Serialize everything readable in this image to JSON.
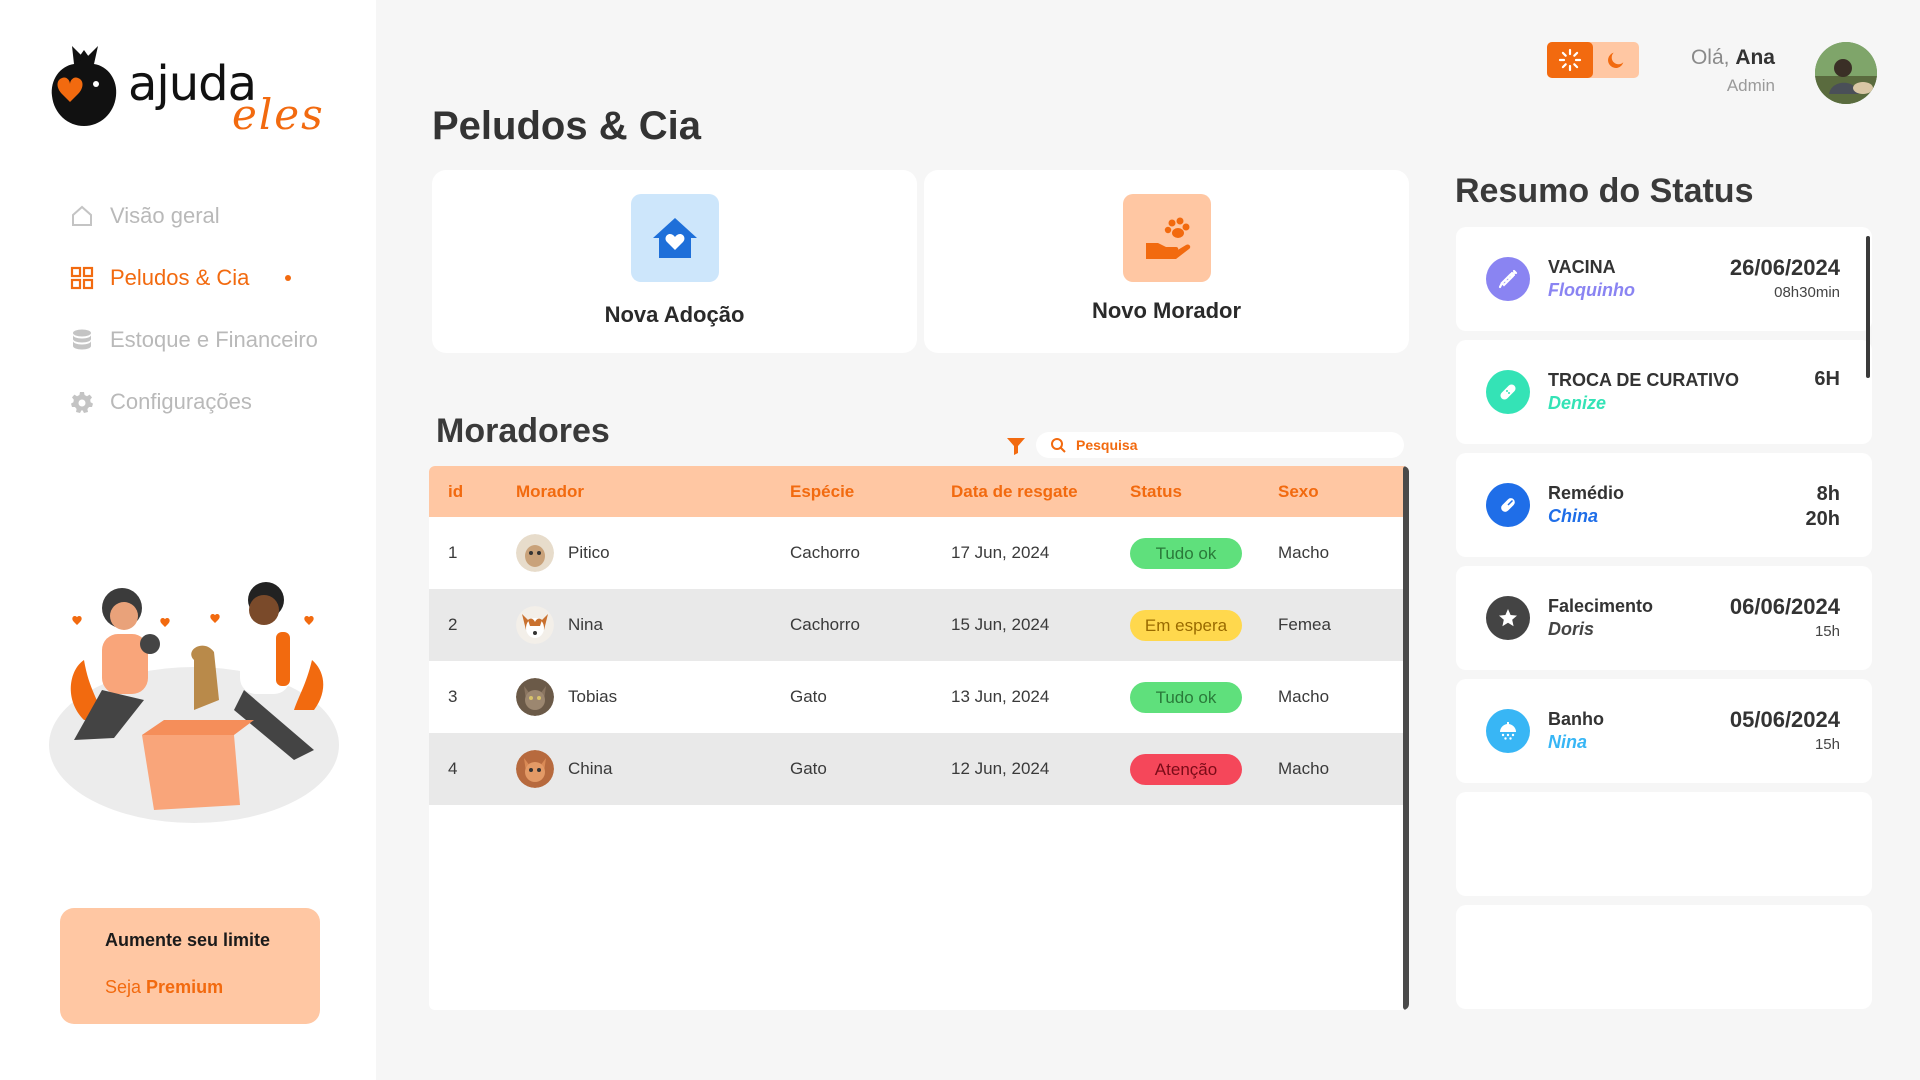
{
  "brand": {
    "name": "ajuda",
    "script": "eles"
  },
  "nav": [
    {
      "label": "Visão geral",
      "icon": "home-icon",
      "active": false
    },
    {
      "label": "Peludos & Cia",
      "icon": "grid-icon",
      "active": true
    },
    {
      "label": "Estoque e Financeiro",
      "icon": "database-icon",
      "active": false
    },
    {
      "label": "Configurações",
      "icon": "gear-icon",
      "active": false
    }
  ],
  "premium": {
    "title": "Aumente seu limite",
    "cta_prefix": "Seja",
    "cta_strong": "Premium"
  },
  "header": {
    "title": "Peludos & Cia",
    "greeting": "Olá,",
    "user_name": "Ana",
    "user_role": "Admin",
    "theme": "light"
  },
  "actions": {
    "adoption": {
      "label": "Nova Adoção",
      "icon": "home-heart-icon",
      "color": "#1e6fd9",
      "bg": "#cde6fb"
    },
    "resident": {
      "label": "Novo Morador",
      "icon": "paw-hand-icon",
      "color": "#f26a0f",
      "bg": "#ffc7a3"
    }
  },
  "residents": {
    "title": "Moradores",
    "search_placeholder": "Pesquisa",
    "columns": [
      "id",
      "Morador",
      "Espécie",
      "Data de resgate",
      "Status",
      "Sexo"
    ],
    "rows": [
      {
        "id": "1",
        "name": "Pitico",
        "species": "Cachorro",
        "date": "17 Jun, 2024",
        "status": "Tudo ok",
        "sex": "Macho"
      },
      {
        "id": "2",
        "name": "Nina",
        "species": "Cachorro",
        "date": "15 Jun, 2024",
        "status": "Em espera",
        "sex": "Femea"
      },
      {
        "id": "3",
        "name": "Tobias",
        "species": "Gato",
        "date": "13 Jun, 2024",
        "status": "Tudo ok",
        "sex": "Macho"
      },
      {
        "id": "4",
        "name": "China",
        "species": "Gato",
        "date": "12 Jun, 2024",
        "status": "Atenção",
        "sex": "Macho"
      }
    ]
  },
  "status_colors": {
    "Tudo ok": "#5fe07c",
    "Em espera": "#ffd84d",
    "Atenção": "#f5475a"
  },
  "status_summary": {
    "title": "Resumo do Status",
    "items": [
      {
        "label": "VACINA",
        "name": "Floquinho",
        "value": "26/06/2024",
        "sub": "08h30min",
        "icon": "syringe-icon",
        "color": "#8a84f2"
      },
      {
        "label": "TROCA DE CURATIVO",
        "name": "Denize",
        "value": "6H",
        "sub": "",
        "icon": "bandage-icon",
        "color": "#34e3b6"
      },
      {
        "label": "Remédio",
        "name": "China",
        "value": "8h",
        "sub": "20h",
        "icon": "pill-icon",
        "color": "#1f6ee8"
      },
      {
        "label": "Falecimento",
        "name": "Doris",
        "value": "06/06/2024",
        "sub": "15h",
        "icon": "star-icon",
        "color": "#444444"
      },
      {
        "label": "Banho",
        "name": "Nina",
        "value": "05/06/2024",
        "sub": "15h",
        "icon": "shower-icon",
        "color": "#38b6f5"
      }
    ]
  }
}
